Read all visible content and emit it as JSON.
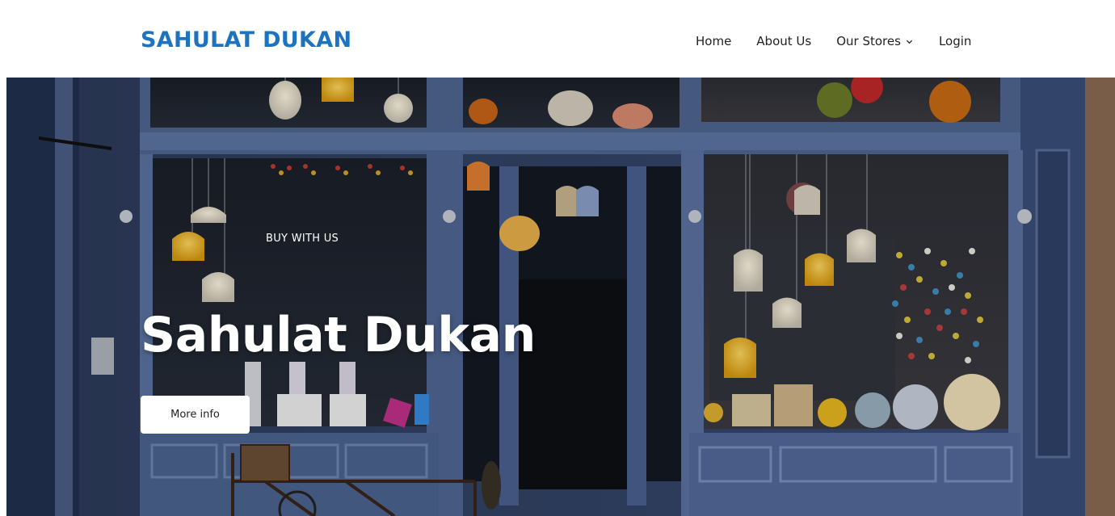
{
  "brand": {
    "name": "SAHULAT DUKAN",
    "color": "#1e73be"
  },
  "nav": {
    "items": [
      {
        "label": "Home"
      },
      {
        "label": "About Us"
      },
      {
        "label": "Our Stores",
        "icon": "chevron-down-icon"
      },
      {
        "label": "Login"
      }
    ]
  },
  "hero": {
    "kicker": "BUY WITH US",
    "title": "Sahulat Dukan",
    "cta_label": "More info",
    "image": "storefront-photo"
  }
}
